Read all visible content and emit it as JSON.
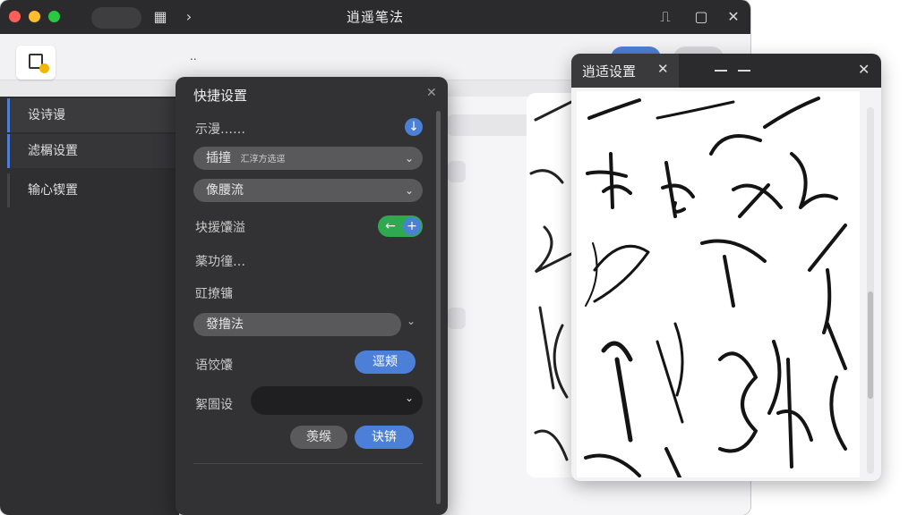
{
  "window": {
    "title": "逍遥笔法"
  },
  "toolbar": {
    "dots": ".."
  },
  "sidebar": {
    "items": [
      {
        "label": "设诗谩"
      },
      {
        "label": "滤榍设置"
      },
      {
        "label": "输心锲置"
      }
    ]
  },
  "quick_settings": {
    "title": "快捷设置",
    "row1_label": "示漫……",
    "select1": {
      "value": "插撞",
      "note": "汇淳方选逕"
    },
    "select2": {
      "value": "像腰流"
    },
    "row_toggle_label": "块援馕溢",
    "row4_label": "薬功徸…",
    "row5_label": "豇撩镛",
    "select3": {
      "value": "發撸法"
    },
    "row6_label": "语饺馕",
    "row6_button": "逕颊",
    "row7_label": "絮圄设",
    "cancel_button": "羡缑",
    "confirm_button": "诀锛"
  },
  "preview_window": {
    "tab_title": "逍适设置"
  },
  "colors": {
    "accent": "#4c7fd8",
    "green": "#2fa84f",
    "dark": "#323234"
  },
  "icons": [
    "cloud-icon",
    "layout-icon",
    "chevron-right-icon",
    "pin-icon",
    "bookmark-icon",
    "close-icon",
    "document-icon",
    "plus-icon",
    "chevron-down-icon",
    "minimize-icon"
  ]
}
